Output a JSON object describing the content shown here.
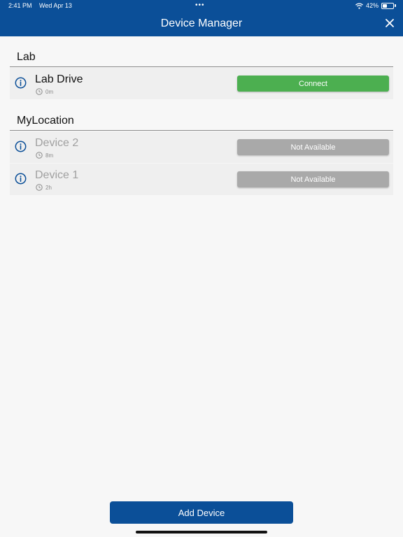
{
  "status_bar": {
    "time": "2:41 PM",
    "date": "Wed Apr 13",
    "dots": "•••",
    "battery_text": "42%",
    "battery_level": 0.42,
    "wifi_icon": "wifi-icon"
  },
  "header": {
    "title": "Device Manager",
    "close_icon": "close-icon",
    "color": "#0b4f98"
  },
  "sections": [
    {
      "title": "Lab",
      "devices": [
        {
          "name": "Lab Drive",
          "time": "0m",
          "button": "Connect",
          "available": true
        }
      ]
    },
    {
      "title": "MyLocation",
      "devices": [
        {
          "name": "Device 2",
          "time": "8m",
          "button": "Not Available",
          "available": false
        },
        {
          "name": "Device 1",
          "time": "2h",
          "button": "Not Available",
          "available": false
        }
      ]
    }
  ],
  "colors": {
    "connect": "#4caf50",
    "unavailable": "#a9a9a9",
    "info_icon": "#0b4f98",
    "name_available": "#111111",
    "name_unavailable": "#a0a0a0"
  },
  "footer": {
    "add_device_label": "Add Device"
  }
}
